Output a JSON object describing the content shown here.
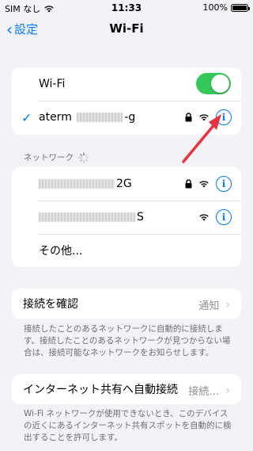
{
  "status_bar": {
    "carrier": "SIM なし",
    "time": "11:33",
    "battery_percent": "100%"
  },
  "nav": {
    "back_label": "設定",
    "title": "Wi-Fi"
  },
  "wifi_toggle": {
    "label": "Wi-Fi",
    "on": true
  },
  "current_network": {
    "name_prefix": "aterm",
    "name_suffix": "-g"
  },
  "networks_section": {
    "header": "ネットワーク",
    "networks": [
      {
        "name_suffix": "2G"
      },
      {
        "name_suffix": "S"
      }
    ],
    "other_label": "その他..."
  },
  "ask_to_join": {
    "label": "接続を確認",
    "value": "通知",
    "description": "接続したことのあるネットワークに自動的に接続します。接続したことのあるネットワークが見つからない場合は、接続可能なネットワークをお知らせします。"
  },
  "auto_join_hotspot": {
    "label": "インターネット共有へ自動接続",
    "value": "接続…",
    "description": "Wi-Fi ネットワークが使用できないとき、このデバイスの近くにあるインターネット共有スポットを自動的に検出することを許可します。"
  },
  "colors": {
    "accent": "#007aff",
    "toggle_on": "#34c759",
    "annotation_arrow": "#e8333c"
  }
}
